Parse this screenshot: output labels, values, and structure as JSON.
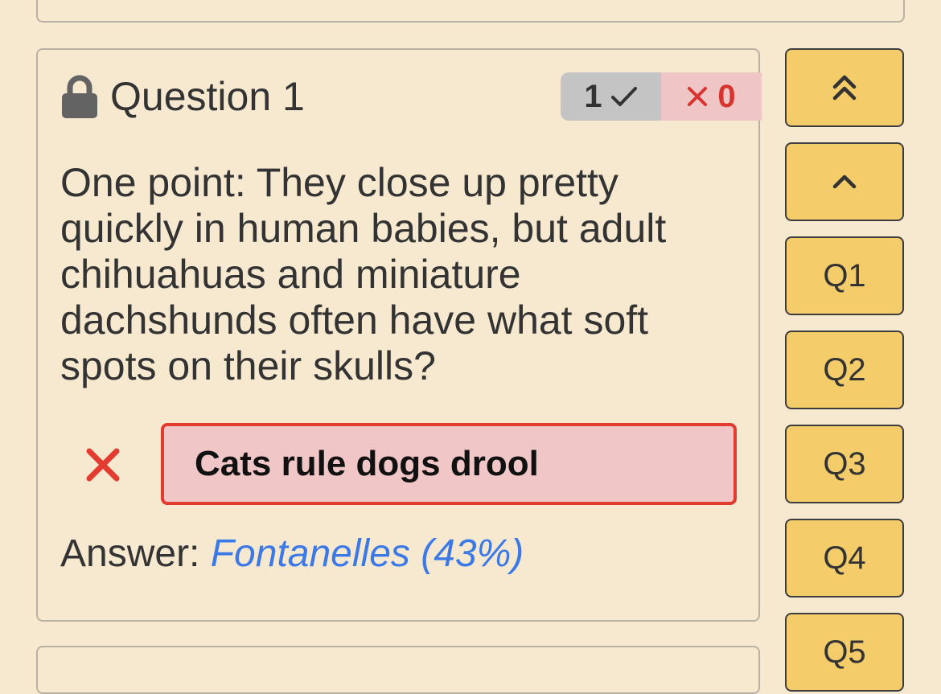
{
  "question": {
    "title": "Question 1",
    "score_correct": "1",
    "score_wrong": "0",
    "text": "One point: They close up pretty quickly in human babies, but adult chihuahuas and miniature dachshunds often have what soft spots on their skulls?",
    "submitted_answer": "Cats rule dogs drool",
    "answer_label": "Answer:",
    "correct_answer": "Fontanelles (43%)",
    "status": "incorrect"
  },
  "navigation": {
    "buttons": [
      {
        "label": "Q1"
      },
      {
        "label": "Q2"
      },
      {
        "label": "Q3"
      },
      {
        "label": "Q4"
      },
      {
        "label": "Q5"
      }
    ]
  },
  "colors": {
    "background": "#f6e9d0",
    "nav_button": "#f4cc6a",
    "wrong_red": "#e33b30",
    "wrong_bg": "#f0c6c6",
    "correct_link": "#3b79e8",
    "score_gray": "#c4c4c4"
  },
  "icons": {
    "lock": "lock-icon",
    "check": "check-icon",
    "cross": "cross-icon",
    "top": "double-chevron-up-icon",
    "up": "chevron-up-icon"
  }
}
